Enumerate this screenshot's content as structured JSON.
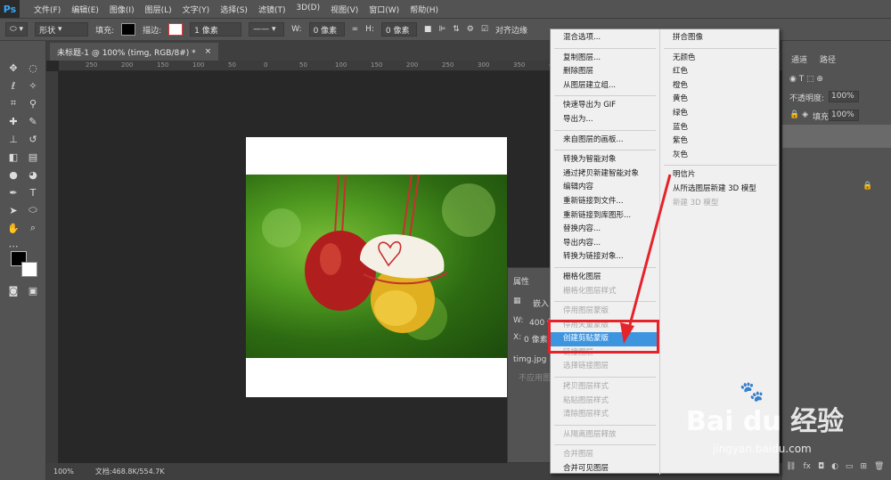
{
  "app": {
    "logo": "Ps"
  },
  "menubar": [
    "文件(F)",
    "编辑(E)",
    "图像(I)",
    "图层(L)",
    "文字(Y)",
    "选择(S)",
    "滤镜(T)",
    "3D(D)",
    "视图(V)",
    "窗口(W)",
    "帮助(H)"
  ],
  "options": {
    "shape_mode": "形状",
    "fill_label": "填充:",
    "stroke_label": "描边:",
    "stroke_width": "1 像素",
    "w_label": "W:",
    "w_value": "0 像素",
    "h_label": "H:",
    "h_value": "0 像素",
    "align_edges": "对齐边缘"
  },
  "document": {
    "tab_title": "未标题-1 @ 100% (timg, RGB/8#) *",
    "close": "×",
    "ruler_marks": [
      "250",
      "200",
      "150",
      "100",
      "50",
      "0",
      "50",
      "100",
      "150",
      "200",
      "250",
      "300",
      "350",
      "400",
      "450",
      "500",
      "550",
      "600",
      "650",
      "700"
    ]
  },
  "status": {
    "zoom": "100%",
    "doc_info": "文档:468.8K/554.7K"
  },
  "properties": {
    "title": "属性",
    "embed": "嵌入",
    "w_label": "W:",
    "w_value": "400 像",
    "x_label": "X:",
    "x_value": "0 像素",
    "file": "timg.jpg",
    "apply": "不应用图"
  },
  "layers": {
    "tab_channels": "通道",
    "tab_paths": "路径",
    "opacity_label": "不透明度:",
    "opacity_value": "100%",
    "fill_label": "填充:",
    "fill_value": "100%"
  },
  "context_menu": {
    "left": [
      {
        "label": "混合选项...",
        "disabled": false
      },
      {
        "sep": true
      },
      {
        "label": "复制图层...",
        "disabled": false
      },
      {
        "label": "删除图层",
        "disabled": false
      },
      {
        "label": "从图层建立组...",
        "disabled": false
      },
      {
        "sep": true
      },
      {
        "label": "快速导出为 GIF",
        "disabled": false
      },
      {
        "label": "导出为...",
        "disabled": false
      },
      {
        "sep": true
      },
      {
        "label": "来自图层的画板...",
        "disabled": false
      },
      {
        "sep": true
      },
      {
        "label": "转换为智能对象",
        "disabled": false
      },
      {
        "label": "通过拷贝新建智能对象",
        "disabled": false
      },
      {
        "label": "编辑内容",
        "disabled": false
      },
      {
        "label": "重新链接到文件...",
        "disabled": false
      },
      {
        "label": "重新链接到库图形...",
        "disabled": false
      },
      {
        "label": "替换内容...",
        "disabled": false
      },
      {
        "label": "导出内容...",
        "disabled": false
      },
      {
        "label": "转换为链接对象...",
        "disabled": false
      },
      {
        "sep": true
      },
      {
        "label": "栅格化图层",
        "disabled": false
      },
      {
        "label": "栅格化图层样式",
        "disabled": true
      },
      {
        "sep": true
      },
      {
        "label": "停用图层蒙版",
        "disabled": true
      },
      {
        "label": "停用矢量蒙版",
        "disabled": true
      },
      {
        "label": "创建剪贴蒙版",
        "disabled": false,
        "highlight": true
      },
      {
        "label": "链接图层",
        "disabled": true
      },
      {
        "label": "选择链接图层",
        "disabled": true
      },
      {
        "sep": true
      },
      {
        "label": "拷贝图层样式",
        "disabled": true
      },
      {
        "label": "粘贴图层样式",
        "disabled": true
      },
      {
        "label": "清除图层样式",
        "disabled": true
      },
      {
        "sep": true
      },
      {
        "label": "从隔离图层释放",
        "disabled": true
      },
      {
        "sep": true
      },
      {
        "label": "合并图层",
        "disabled": true
      },
      {
        "label": "合并可见图层",
        "disabled": false
      }
    ],
    "right": [
      {
        "label": "拼合图像",
        "disabled": false
      },
      {
        "sep": true
      },
      {
        "label": "无颜色",
        "disabled": false
      },
      {
        "label": "红色",
        "disabled": false
      },
      {
        "label": "橙色",
        "disabled": false
      },
      {
        "label": "黄色",
        "disabled": false
      },
      {
        "label": "绿色",
        "disabled": false
      },
      {
        "label": "蓝色",
        "disabled": false
      },
      {
        "label": "紫色",
        "disabled": false
      },
      {
        "label": "灰色",
        "disabled": false
      },
      {
        "sep": true
      },
      {
        "label": "明信片",
        "disabled": false
      },
      {
        "label": "从所选图层新建 3D 模型",
        "disabled": false
      },
      {
        "label": "新建 3D 模型",
        "disabled": true
      }
    ]
  },
  "watermark": {
    "brand": "Bai du 经验",
    "url": "jingyan.baidu.com"
  },
  "colors": {
    "highlight": "#3d95e0",
    "annotation": "#e5232a",
    "ps_blue": "#31a8ff"
  }
}
